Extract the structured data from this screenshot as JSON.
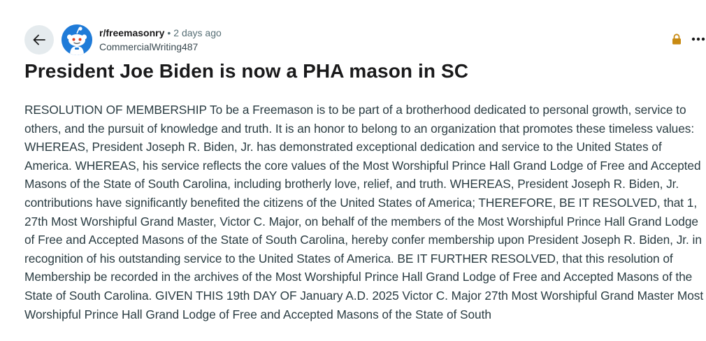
{
  "post": {
    "subreddit": "r/freemasonry",
    "separator": "•",
    "time_ago": "2 days ago",
    "author": "CommercialWriting487",
    "title": "President Joe Biden is now a PHA mason in SC",
    "body": "RESOLUTION OF MEMBERSHIP To be a Freemason is to be part of a brotherhood dedicated to personal growth, service to others, and the pursuit of knowledge and truth. It is an honor to belong to an organization that promotes these timeless values: WHEREAS, President Joseph R. Biden, Jr. has demonstrated exceptional dedication and service to the United States of America. WHEREAS, his service reflects the core values of the Most Worshipful Prince Hall Grand Lodge of Free and Accepted Masons of the State of South Carolina, including brotherly love, relief, and truth. WHEREAS, President Joseph R. Biden, Jr. contributions have significantly benefited the citizens of the United States of America; THEREFORE, BE IT RESOLVED, that 1, 27th Most Worshipful Grand Master, Victor C. Major, on behalf of the members of the Most Worshipful Prince Hall Grand Lodge of Free and Accepted Masons of the State of South Carolina, hereby confer membership upon President Joseph R. Biden, Jr. in recognition of his outstanding service to the United States of America. BE IT FURTHER RESOLVED, that this resolution of Membership be recorded in the archives of the Most Worshipful Prince Hall Grand Lodge of Free and Accepted Masons of the State of South Carolina. GIVEN THIS 19th DAY OF January A.D. 2025 Victor C. Major 27th Most Worshipful Grand Master Most Worshipful Prince Hall Grand Lodge of Free and Accepted Masons of the State of South"
  },
  "icons": {
    "back": "arrow-left-icon",
    "avatar": "reddit-snoo-icon",
    "lock": "lock-icon",
    "more": "more-horizontal-icon"
  },
  "colors": {
    "back_button_bg": "#e5ebee",
    "avatar_bg": "#1f7bd8",
    "lock": "#c88a12",
    "title": "#1a1a1b",
    "body_text": "#2a3c42"
  }
}
